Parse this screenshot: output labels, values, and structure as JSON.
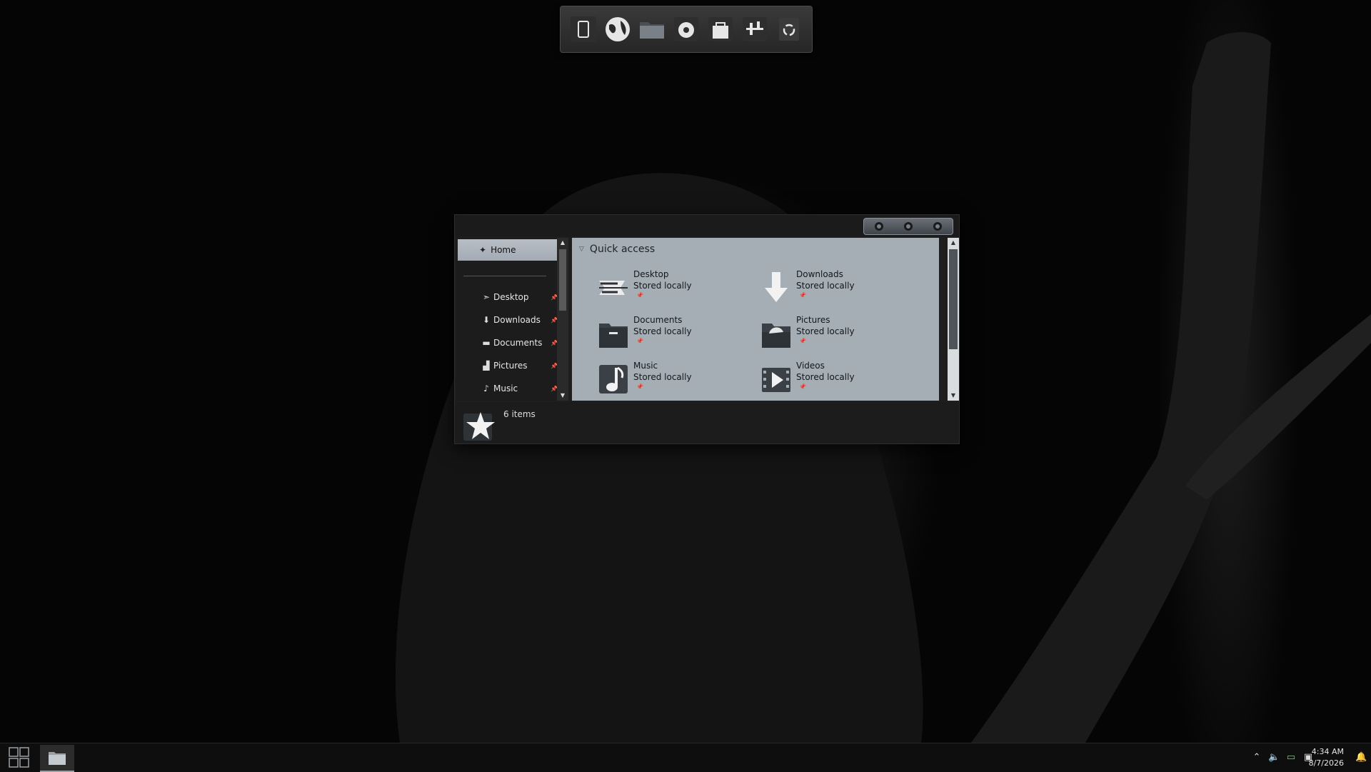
{
  "dock": {
    "items": [
      {
        "icon": "phone-icon"
      },
      {
        "icon": "browser-globe-icon"
      },
      {
        "icon": "folder-icon"
      },
      {
        "icon": "media-player-icon"
      },
      {
        "icon": "store-bag-icon"
      },
      {
        "icon": "settings-sliders-icon"
      },
      {
        "icon": "recycle-bin-icon"
      }
    ]
  },
  "window": {
    "nav": {
      "home_label": "Home",
      "items": [
        {
          "label": "Desktop",
          "icon": "desktop-icon"
        },
        {
          "label": "Downloads",
          "icon": "download-arrow-icon"
        },
        {
          "label": "Documents",
          "icon": "documents-icon"
        },
        {
          "label": "Pictures",
          "icon": "pictures-icon"
        },
        {
          "label": "Music",
          "icon": "music-note-icon"
        }
      ]
    },
    "quick_access": {
      "title": "Quick access",
      "tiles": [
        {
          "name": "Desktop",
          "status": "Stored locally",
          "icon": "desktop-icon"
        },
        {
          "name": "Downloads",
          "status": "Stored locally",
          "icon": "download-arrow-icon"
        },
        {
          "name": "Documents",
          "status": "Stored locally",
          "icon": "documents-icon"
        },
        {
          "name": "Pictures",
          "status": "Stored locally",
          "icon": "pictures-icon"
        },
        {
          "name": "Music",
          "status": "Stored locally",
          "icon": "music-note-icon"
        },
        {
          "name": "Videos",
          "status": "Stored locally",
          "icon": "video-play-icon"
        }
      ]
    },
    "status": {
      "item_count": "6 items"
    }
  },
  "taskbar": {
    "time": "4:34 AM",
    "date": "8/7/2026"
  },
  "colors": {
    "content_bg": "#a5adb5",
    "chrome_dark": "#1e1e1e",
    "taskbar": "#0e0e0e"
  }
}
